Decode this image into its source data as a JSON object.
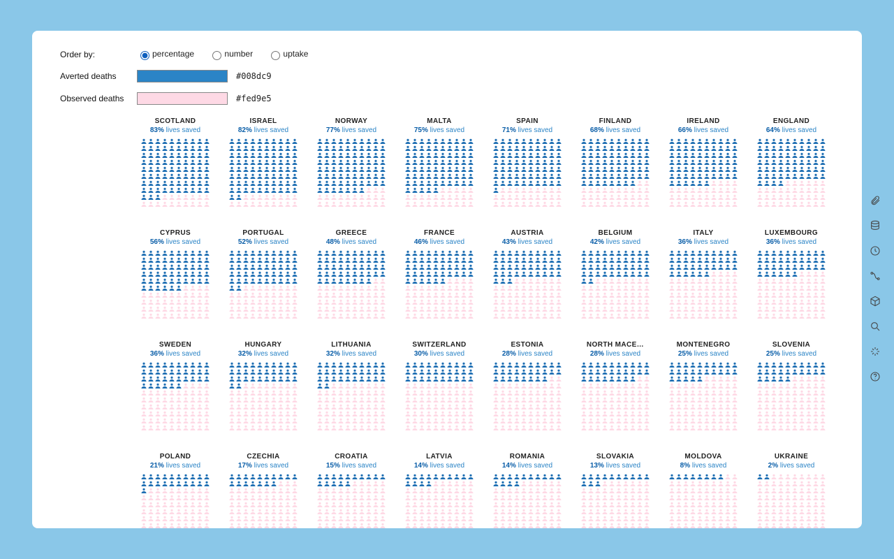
{
  "controls": {
    "order_by_label": "Order by:",
    "order_options": [
      "percentage",
      "number",
      "uptake"
    ],
    "order_selected": "percentage",
    "averted_label": "Averted deaths",
    "averted_hex": "#008dc9",
    "observed_label": "Observed deaths",
    "observed_hex": "#fed9e5",
    "lives_saved_text": "lives saved"
  },
  "toolbar_icons": [
    "attachment",
    "database",
    "clock",
    "curve",
    "cube",
    "search",
    "sparkles",
    "help"
  ],
  "chart_data": {
    "type": "bar",
    "title": "",
    "unit": "% lives saved",
    "grid_total": 100,
    "columns_per_row": 10,
    "series": [
      {
        "name": "SCOTLAND",
        "pct": 83
      },
      {
        "name": "ISRAEL",
        "pct": 82
      },
      {
        "name": "NORWAY",
        "pct": 77
      },
      {
        "name": "MALTA",
        "pct": 75
      },
      {
        "name": "SPAIN",
        "pct": 71
      },
      {
        "name": "FINLAND",
        "pct": 68
      },
      {
        "name": "IRELAND",
        "pct": 66
      },
      {
        "name": "ENGLAND",
        "pct": 64
      },
      {
        "name": "CYPRUS",
        "pct": 56
      },
      {
        "name": "PORTUGAL",
        "pct": 52
      },
      {
        "name": "GREECE",
        "pct": 48
      },
      {
        "name": "FRANCE",
        "pct": 46
      },
      {
        "name": "AUSTRIA",
        "pct": 43
      },
      {
        "name": "BELGIUM",
        "pct": 42
      },
      {
        "name": "ITALY",
        "pct": 36
      },
      {
        "name": "LUXEMBOURG",
        "pct": 36
      },
      {
        "name": "SWEDEN",
        "pct": 36
      },
      {
        "name": "HUNGARY",
        "pct": 32
      },
      {
        "name": "LITHUANIA",
        "pct": 32
      },
      {
        "name": "SWITZERLAND",
        "pct": 30
      },
      {
        "name": "ESTONIA",
        "pct": 28
      },
      {
        "name": "NORTH MACE…",
        "pct": 28
      },
      {
        "name": "MONTENEGRO",
        "pct": 25
      },
      {
        "name": "SLOVENIA",
        "pct": 25
      },
      {
        "name": "POLAND",
        "pct": 21
      },
      {
        "name": "CZECHIA",
        "pct": 17
      },
      {
        "name": "CROATIA",
        "pct": 15
      },
      {
        "name": "LATVIA",
        "pct": 14
      },
      {
        "name": "ROMANIA",
        "pct": 14
      },
      {
        "name": "SLOVAKIA",
        "pct": 13
      },
      {
        "name": "MOLDOVA",
        "pct": 8
      },
      {
        "name": "UKRAINE",
        "pct": 2
      }
    ]
  }
}
